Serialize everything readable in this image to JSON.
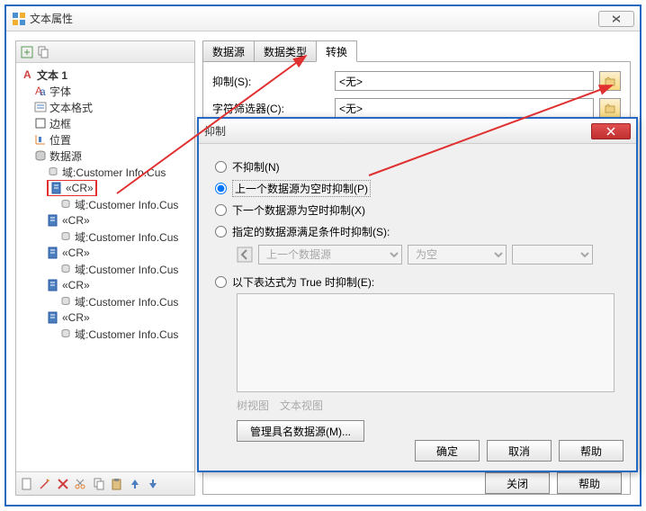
{
  "main_window": {
    "title": "文本属性"
  },
  "tree": {
    "root": "文本 1",
    "font": "字体",
    "text_format": "文本格式",
    "border": "边框",
    "position": "位置",
    "data_source": "数据源",
    "field_prefix": "域:Customer Info.Cus",
    "cr": "«CR»"
  },
  "tabs": {
    "data_source": "数据源",
    "data_type": "数据类型",
    "convert": "转换"
  },
  "form": {
    "suppress_label": "抑制(S):",
    "suppress_value": "<无>",
    "char_filter_label": "字符筛选器(C):",
    "char_filter_value": "<无>"
  },
  "dialog": {
    "title": "抑制",
    "opt_none": "不抑制(N)",
    "opt_prev_empty": "上一个数据源为空时抑制(P)",
    "opt_next_empty": "下一个数据源为空时抑制(X)",
    "opt_specified": "指定的数据源满足条件时抑制(S):",
    "sub_select1": "上一个数据源",
    "sub_select2": "为空",
    "opt_expression": "以下表达式为 True 时抑制(E):",
    "view_tree": "树视图",
    "view_text": "文本视图",
    "manage_btn": "管理具名数据源(M)...",
    "ok": "确定",
    "cancel": "取消",
    "help": "帮助"
  },
  "footer": {
    "close": "关闭",
    "help": "帮助"
  }
}
